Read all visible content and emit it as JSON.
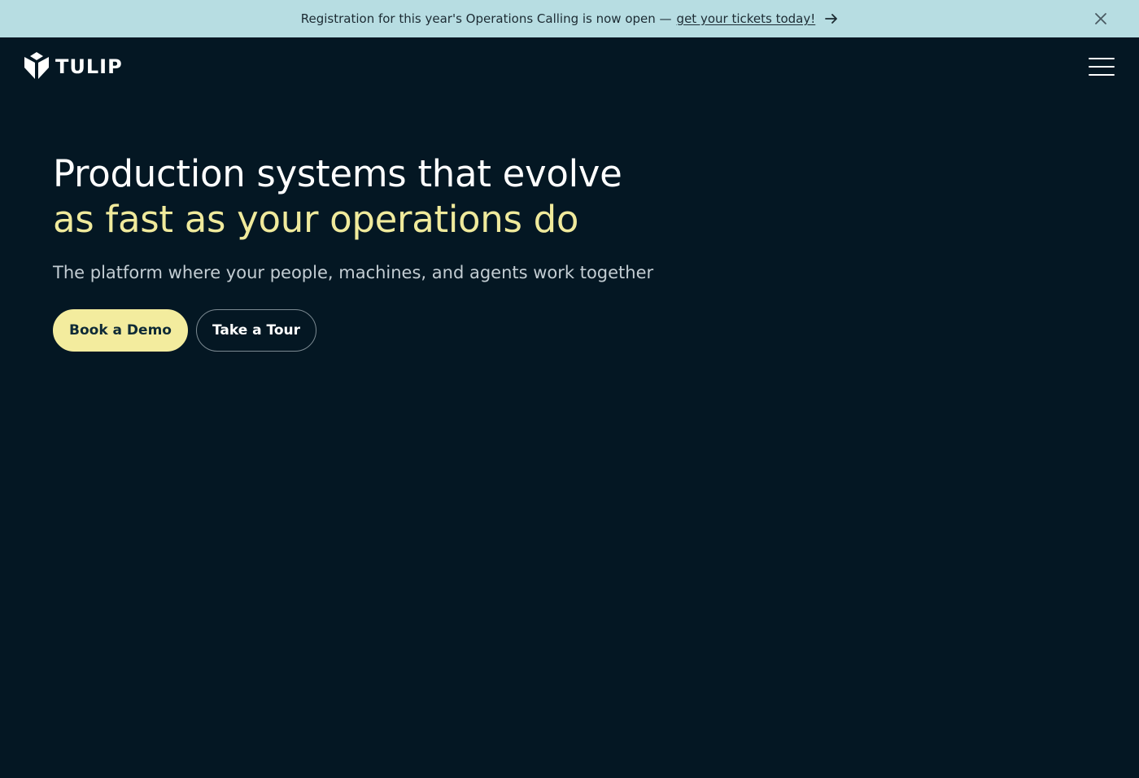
{
  "banner": {
    "text": "Registration for this year's Operations Calling is now open —",
    "link_text": "get your tickets today!",
    "arrow_icon": "arrow-right-icon",
    "close_icon": "close-icon"
  },
  "header": {
    "logo_text": "TULIP",
    "logo_icon": "tulip-logo-icon",
    "menu_icon": "hamburger-menu-icon"
  },
  "hero": {
    "title_line1": "Production systems that evolve",
    "title_line2": "as fast as your operations do",
    "subtitle": "The platform where your people, machines, and agents work together",
    "primary_button": "Book a Demo",
    "secondary_button": "Take a Tour"
  },
  "colors": {
    "background": "#041723",
    "banner_bg": "#b7dde2",
    "accent_yellow": "#f0ea9c",
    "button_primary_bg": "#f3ec9e",
    "text_white": "#ffffff"
  }
}
